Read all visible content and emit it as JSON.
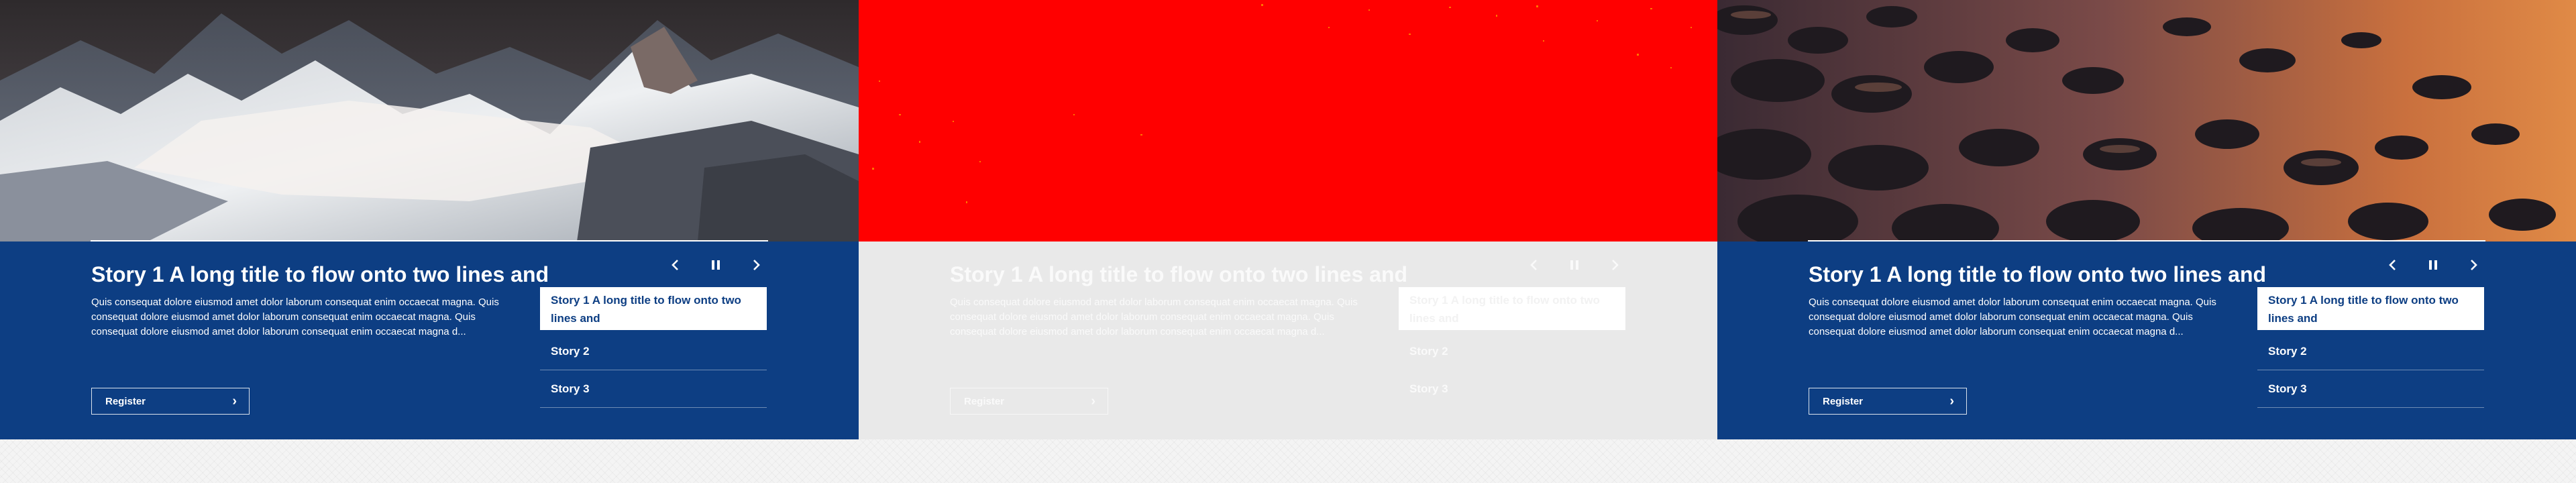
{
  "slides": [
    {
      "state": "normal",
      "hero_scene": "snowy-mountains",
      "title": "Story 1 A long title to flow onto two lines and",
      "description": "Quis consequat dolore eiusmod amet dolor laborum consequat enim occaecat magna. Quis consequat dolore eiusmod amet dolor laborum consequat enim occaecat magna. Quis consequat dolore eiusmod amet dolor laborum consequat enim occaecat magna d...",
      "button_label": "Register",
      "controls": {
        "previous": "chevron-left-icon",
        "pause": "pause-icon",
        "next": "chevron-right-icon"
      },
      "stories": [
        "Story 1 A long title to flow onto two lines and",
        "Story 2",
        "Story 3"
      ]
    },
    {
      "state": "disabled",
      "hero_scene": "solid-red",
      "title": "Story 1 A long title to flow onto two lines and",
      "description": "Quis consequat dolore eiusmod amet dolor laborum consequat enim occaecat magna. Quis consequat dolore eiusmod amet dolor laborum consequat enim occaecat magna. Quis consequat dolore eiusmod amet dolor laborum consequat enim occaecat magna d...",
      "button_label": "Register",
      "controls": {
        "previous": "chevron-left-icon",
        "pause": "pause-icon",
        "next": "chevron-right-icon"
      },
      "stories": [
        "Story 1 A long title to flow onto two lines and",
        "Story 2",
        "Story 3"
      ]
    },
    {
      "state": "normal",
      "hero_scene": "rocky-shore-sunset",
      "title": "Story 1 A long title to flow onto two lines and",
      "description": "Quis consequat dolore eiusmod amet dolor laborum consequat enim occaecat magna. Quis consequat dolore eiusmod amet dolor laborum consequat enim occaecat magna. Quis consequat dolore eiusmod amet dolor laborum consequat enim occaecat magna d...",
      "button_label": "Register",
      "controls": {
        "previous": "chevron-left-icon",
        "pause": "pause-icon",
        "next": "chevron-right-icon"
      },
      "stories": [
        "Story 1 A long title to flow onto two lines and",
        "Story 2",
        "Story 3"
      ]
    }
  ],
  "colors": {
    "brand_blue": "#0d3e83",
    "disabled_grey": "#e9e9e9",
    "hero_red": "#ff0000",
    "text_light": "#ffffff"
  }
}
